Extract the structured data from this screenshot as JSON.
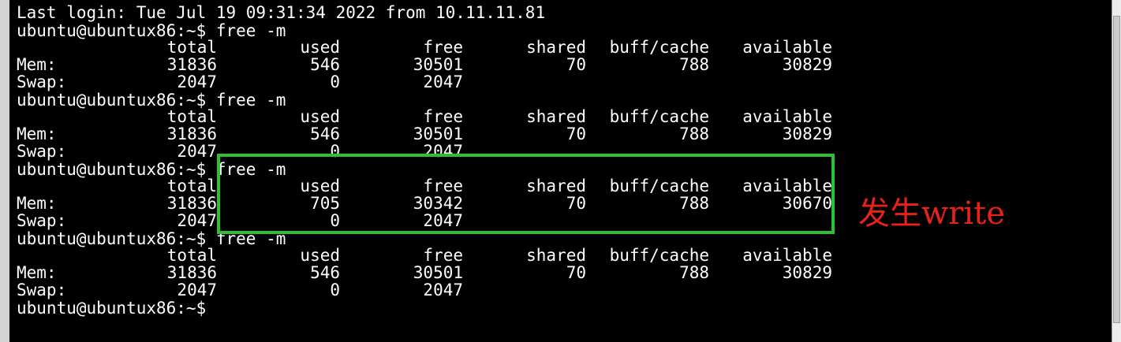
{
  "terminal": {
    "login_line": "Last login: Tue Jul 19 09:31:34 2022 from 10.11.11.81",
    "prompt": "ubuntu@ubuntux86:~$",
    "blocks": [
      {
        "command": "free -m",
        "headers": [
          "total",
          "used",
          "free",
          "shared",
          "buff/cache",
          "available"
        ],
        "mem": {
          "label": "Mem:",
          "total": "31836",
          "used": "546",
          "free": "30501",
          "shared": "70",
          "buff_cache": "788",
          "available": "30829"
        },
        "swap": {
          "label": "Swap:",
          "total": "2047",
          "used": "0",
          "free": "2047"
        }
      },
      {
        "command": "free -m",
        "headers": [
          "total",
          "used",
          "free",
          "shared",
          "buff/cache",
          "available"
        ],
        "mem": {
          "label": "Mem:",
          "total": "31836",
          "used": "546",
          "free": "30501",
          "shared": "70",
          "buff_cache": "788",
          "available": "30829"
        },
        "swap": {
          "label": "Swap:",
          "total": "2047",
          "used": "0",
          "free": "2047"
        }
      },
      {
        "command": "free -m",
        "headers": [
          "total",
          "used",
          "free",
          "shared",
          "buff/cache",
          "available"
        ],
        "mem": {
          "label": "Mem:",
          "total": "31836",
          "used": "705",
          "free": "30342",
          "shared": "70",
          "buff_cache": "788",
          "available": "30670"
        },
        "swap": {
          "label": "Swap:",
          "total": "2047",
          "used": "0",
          "free": "2047"
        }
      },
      {
        "command": "free -m",
        "headers": [
          "total",
          "used",
          "free",
          "shared",
          "buff/cache",
          "available"
        ],
        "mem": {
          "label": "Mem:",
          "total": "31836",
          "used": "546",
          "free": "30501",
          "shared": "70",
          "buff_cache": "788",
          "available": "30829"
        },
        "swap": {
          "label": "Swap:",
          "total": "2047",
          "used": "0",
          "free": "2047"
        }
      }
    ],
    "final_prompt": "ubuntu@ubuntux86:~$"
  },
  "annotation": {
    "text": "发生write",
    "color": "#e8221b"
  },
  "highlight": {
    "color": "#2fbf33"
  },
  "colors": {
    "background": "#000000",
    "foreground": "#ffffff"
  }
}
